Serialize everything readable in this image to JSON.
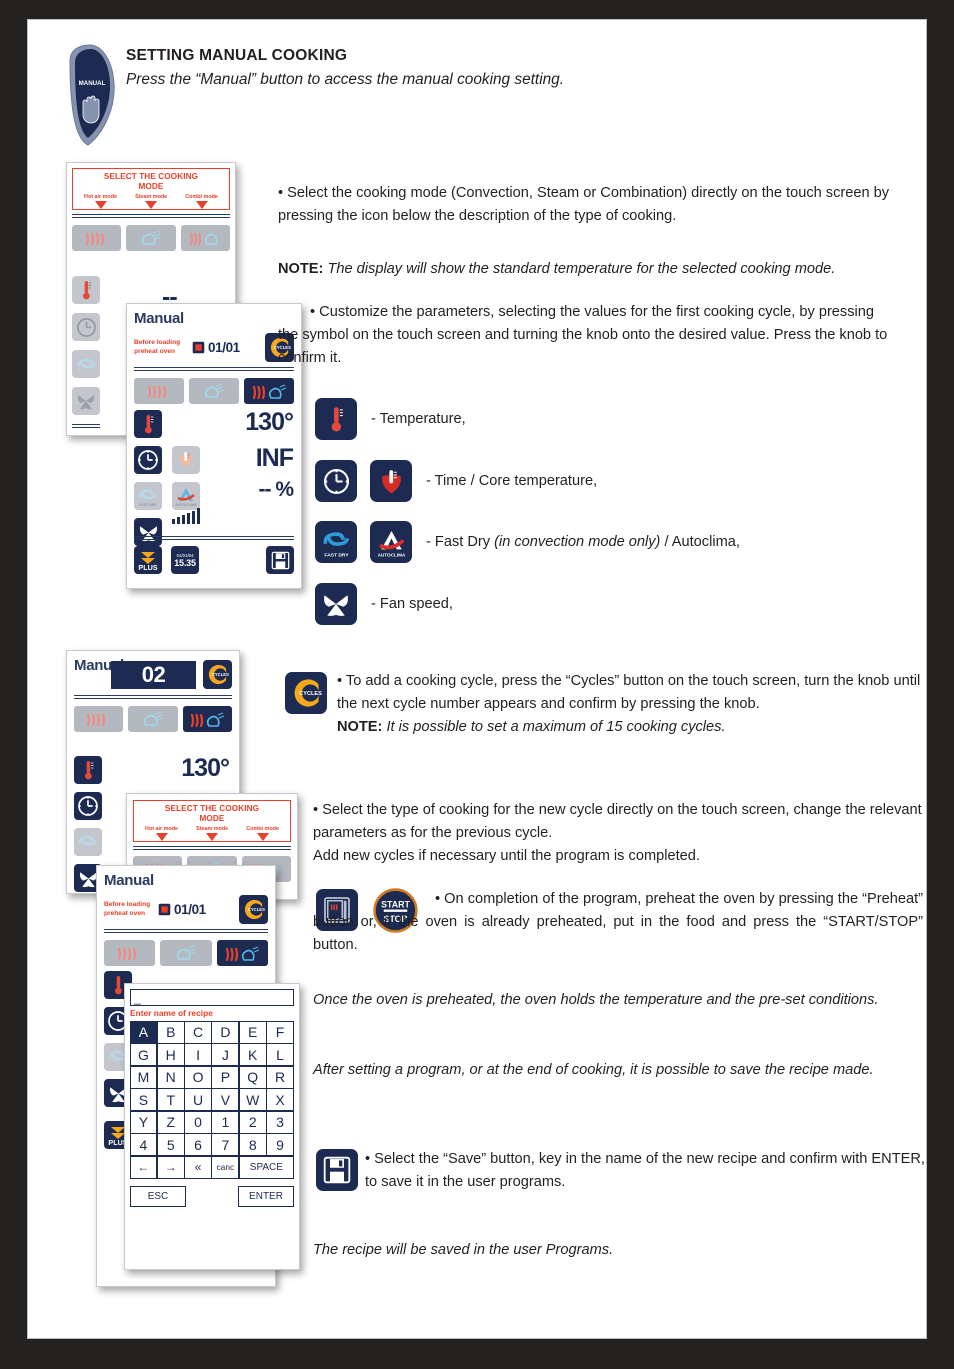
{
  "header": {
    "tab_label": "MANUAL",
    "tab_icon": "hand-icon",
    "title": "SETTING MANUAL COOKING",
    "subtitle": "Press the “Manual” button to access the manual cooking setting."
  },
  "select_mode_box": {
    "title_line1": "SELECT THE COOKING",
    "title_line2": "MODE",
    "columns": [
      "Hot air mode",
      "Steam mode",
      "Combi mode"
    ]
  },
  "screen_manual_1": {
    "title": "Manual",
    "warning_line1": "Before loading",
    "warning_line2": "preheat oven",
    "cycle_counter": "01/01",
    "cycles_label": "CYCLES",
    "temperature": "130°",
    "time": "INF",
    "humidity": "-- %",
    "fan_bars": 6,
    "clock_date": "01/01/04",
    "clock_time": "15.35",
    "plus_label": "PLUS",
    "fast_dry_label": "FAST DRY",
    "autoclima_label": "AUTOCLIMA"
  },
  "screen_manual_2": {
    "title": "Manual",
    "cycle_number": "02",
    "cycles_label": "CYCLES",
    "temperature": "130°"
  },
  "screen_manual_3": {
    "title": "Manual",
    "warning_line1": "Before loading",
    "warning_line2": "preheat oven",
    "cycle_counter": "01/01",
    "cycles_label": "CYCLES"
  },
  "keyboard": {
    "input_value": "_",
    "hint": "Enter name of recipe",
    "rows": [
      [
        "A",
        "B",
        "C",
        "D",
        "E",
        "F"
      ],
      [
        "G",
        "H",
        "I",
        "J",
        "K",
        "L"
      ],
      [
        "M",
        "N",
        "O",
        "P",
        "Q",
        "R"
      ],
      [
        "S",
        "T",
        "U",
        "V",
        "W",
        "X"
      ],
      [
        "Y",
        "Z",
        "0",
        "1",
        "2",
        "3"
      ],
      [
        "4",
        "5",
        "6",
        "7",
        "8",
        "9"
      ]
    ],
    "selected_key": "A",
    "nav_row": [
      "←",
      "→",
      "«",
      "canc",
      "SPACE"
    ],
    "esc_label": "ESC",
    "enter_label": "ENTER"
  },
  "text_blocks": {
    "b1": "• Select the cooking mode (Convection, Steam or Combination) directly on the touch screen by pressing the icon below the description of the type of cooking.",
    "note1_label": "NOTE:",
    "note1_body": "The display will show the standard temperature for the selected cooking mode.",
    "b2": "• Customize the parameters, selecting the values for the first cooking cycle, by pressing the symbol on the touch screen and turning the knob onto the desired value. Press the knob to confirm it.",
    "b3": "• To add a cooking cycle, press the “Cycles” button on the touch screen, turn the knob until the next cycle number appears and confirm by pressing the knob.",
    "note2_label": "NOTE:",
    "note2_body": "It is possible to set a maximum of 15 cooking cycles.",
    "b4_line1": "• Select the type of cooking for the new cycle directly on the touch screen, change the relevant parameters as for the previous cycle.",
    "b4_line2": "Add new cycles if necessary until the program is completed.",
    "b5": "• On completion of the program, preheat the oven by pressing the “Preheat” button or, if the oven is already preheated, put in the food and press the “START/STOP” button.",
    "b6": "Once the oven is preheated, the oven holds the temperature and the pre-set conditions.",
    "b7": "After setting a program, or at the end of cooking, it is possible to save the recipe made.",
    "b8": "• Select the “Save” button, key in the name of the new recipe and confirm with ENTER, to save it in the user programs.",
    "b9": "The recipe will be saved in the user Programs."
  },
  "legend": [
    {
      "text": "- Temperature,",
      "icons": [
        "thermometer-icon"
      ]
    },
    {
      "text": "- Time / Core temperature,",
      "icons": [
        "clock-icon",
        "core-probe-icon"
      ]
    },
    {
      "text_pre": "- Fast Dry ",
      "text_it": "(in convection mode only)",
      "text_post": " / Autoclima,",
      "icons": [
        "fast-dry-icon",
        "autoclima-icon"
      ]
    },
    {
      "text": "- Fan speed,",
      "icons": [
        "fan-icon"
      ]
    }
  ],
  "buttons": {
    "start_stop_line1": "START",
    "start_stop_line2": "STOP",
    "preheat_icon": "preheat-oven-icon",
    "save_icon": "floppy-save-icon",
    "cycles_icon": "cycles-icon"
  },
  "colors": {
    "navy": "#1d2a51",
    "red": "#e8402a",
    "grey": "#b4b8bf",
    "orange": "#f5a81c",
    "page_border": "#242121"
  }
}
